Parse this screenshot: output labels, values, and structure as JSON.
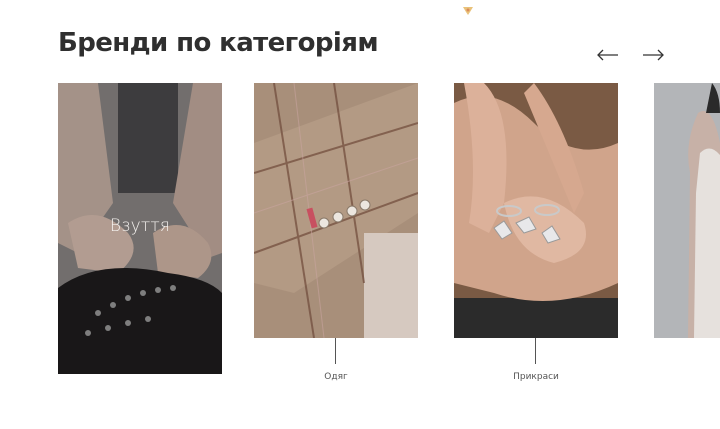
{
  "section": {
    "title": "Бренди по категоріям",
    "prev_icon": "arrow-left-icon",
    "next_icon": "arrow-right-icon"
  },
  "cards": [
    {
      "label": "Взуття",
      "image": "boots-lacing-photo",
      "state": "active"
    },
    {
      "label": "Одяг",
      "image": "plaid-jacket-sleeve-photo"
    },
    {
      "label": "Прикраси",
      "image": "hands-rings-photo"
    },
    {
      "image": "dress-photo"
    }
  ],
  "colors": {
    "title": "#2f2f2f",
    "label": "#555555",
    "overlay_text": "#f4f1ee"
  }
}
